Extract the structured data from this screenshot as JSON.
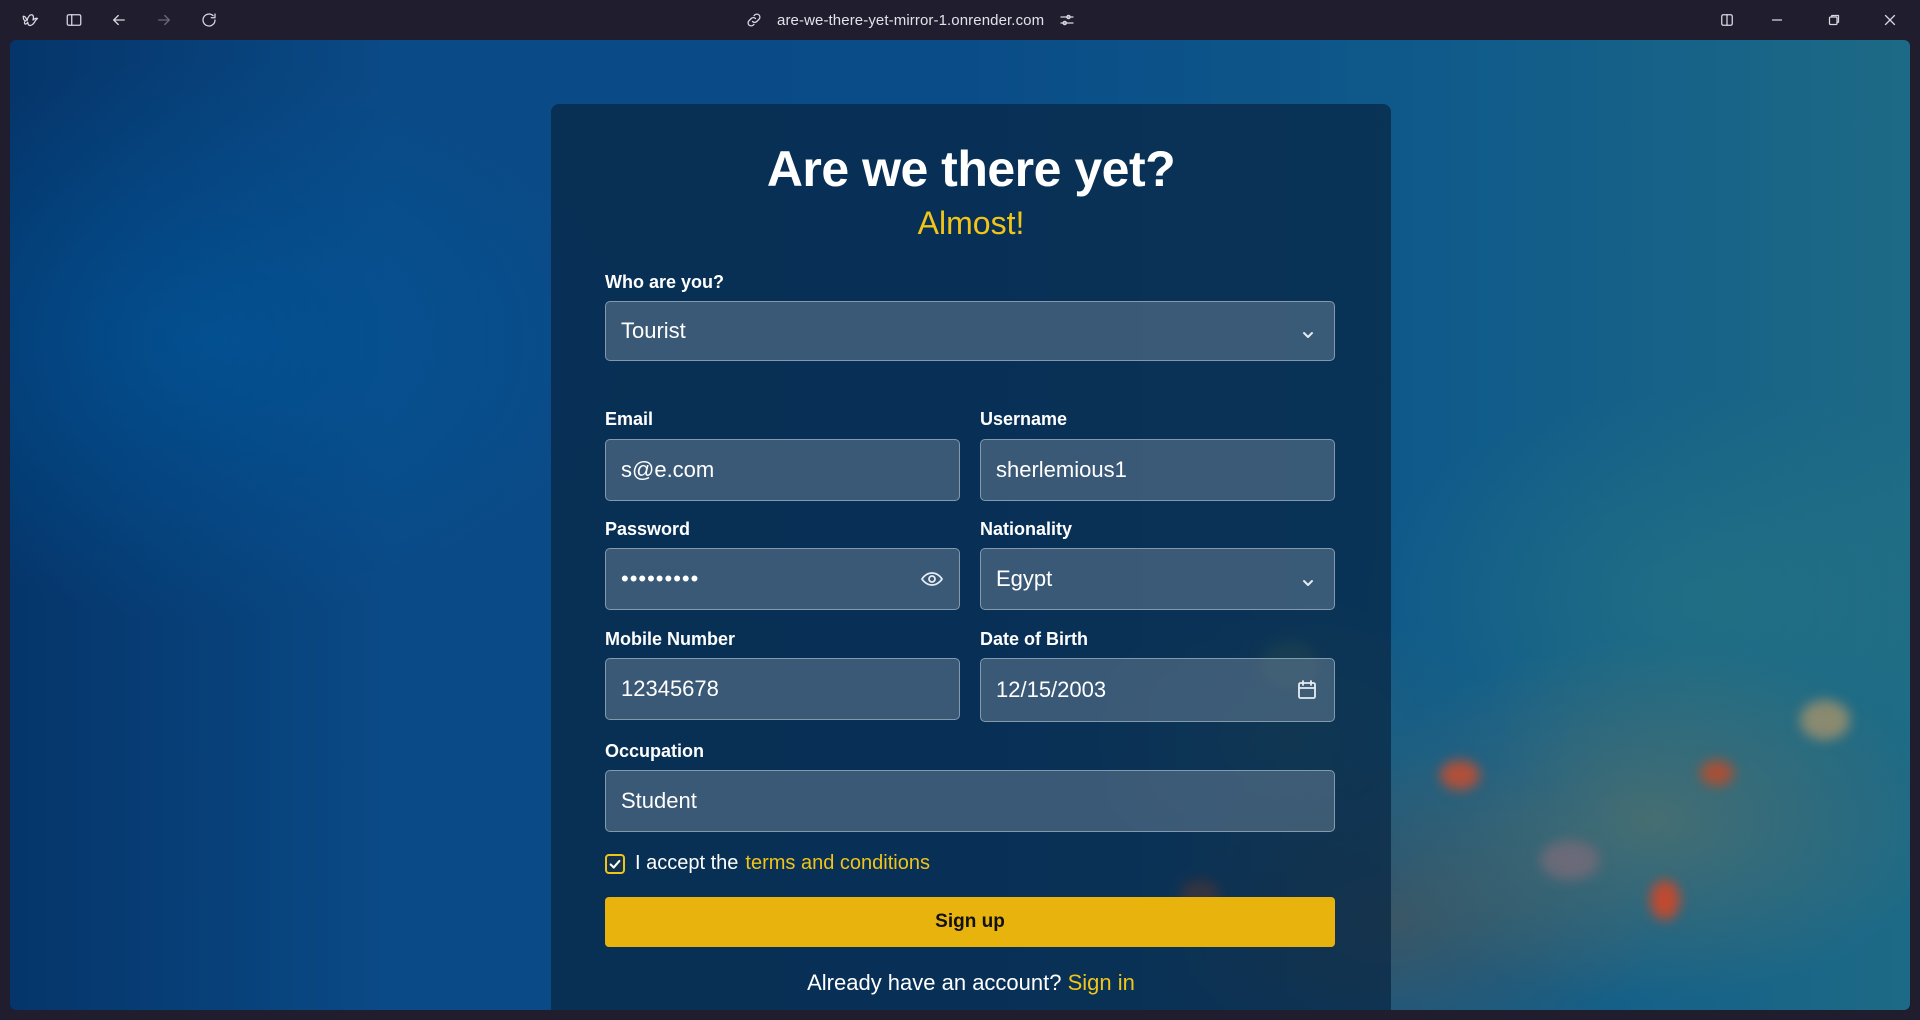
{
  "browser": {
    "url": "are-we-there-yet-mirror-1.onrender.com"
  },
  "form": {
    "title": "Are we there yet?",
    "subtitle": "Almost!",
    "who_label": "Who are you?",
    "who_value": "Tourist",
    "email_label": "Email",
    "email_value": "s@e.com",
    "username_label": "Username",
    "username_value": "sherlemious1",
    "password_label": "Password",
    "password_mask": "•••••••••",
    "nationality_label": "Nationality",
    "nationality_value": "Egypt",
    "mobile_label": "Mobile Number",
    "mobile_value": "12345678",
    "dob_label": "Date of Birth",
    "dob_value": "12/15/2003",
    "occupation_label": "Occupation",
    "occupation_value": "Student",
    "terms_prefix": "I accept the",
    "terms_link": "terms and conditions",
    "terms_checked": true,
    "signup_label": "Sign up",
    "already_text": "Already have an account?",
    "signin_link": "Sign in"
  },
  "colors": {
    "accent": "#f0c419",
    "button": "#e8b30c"
  }
}
